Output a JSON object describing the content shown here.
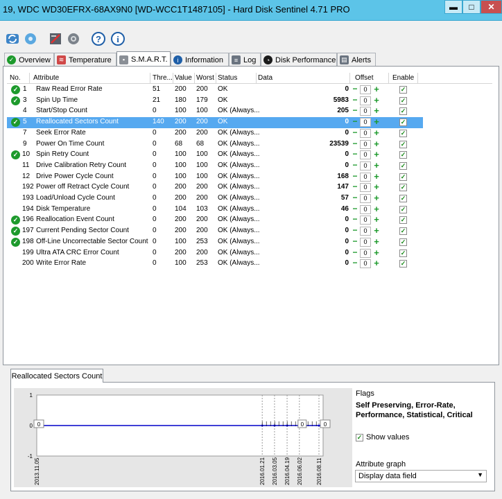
{
  "window": {
    "title": "19, WDC WD30EFRX-68AX9N0 [WD-WCC1T1487105]  -  Hard Disk Sentinel 4.71 PRO",
    "min_glyph": "▬",
    "max_glyph": "□",
    "close_glyph": "✕"
  },
  "toolbar": {
    "icons": [
      "refresh-icon",
      "disk-settings-icon",
      "report-icon",
      "settings-icon",
      "help-icon",
      "info-icon"
    ]
  },
  "tabs": [
    {
      "label": "Overview",
      "icon": "check-icon"
    },
    {
      "label": "Temperature",
      "icon": "thermometer-icon"
    },
    {
      "label": "S.M.A.R.T.",
      "icon": "smart-icon",
      "active": true
    },
    {
      "label": "Information",
      "icon": "info-icon"
    },
    {
      "label": "Log",
      "icon": "log-icon"
    },
    {
      "label": "Disk Performance",
      "icon": "performance-icon"
    },
    {
      "label": "Alerts",
      "icon": "alerts-icon"
    }
  ],
  "grid": {
    "headers": [
      "No.",
      "Attribute",
      "Thre...",
      "Value",
      "Worst",
      "Status",
      "Data",
      "Offset",
      "Enable"
    ],
    "rows": [
      {
        "ok": true,
        "no": "1",
        "attr": "Raw Read Error Rate",
        "thr": "51",
        "val": "200",
        "worst": "200",
        "status": "OK",
        "data": "0",
        "offset": "0"
      },
      {
        "ok": true,
        "no": "3",
        "attr": "Spin Up Time",
        "thr": "21",
        "val": "180",
        "worst": "179",
        "status": "OK",
        "data": "5983",
        "offset": "0"
      },
      {
        "ok": false,
        "no": "4",
        "attr": "Start/Stop Count",
        "thr": "0",
        "val": "100",
        "worst": "100",
        "status": "OK (Always...",
        "data": "205",
        "offset": "0"
      },
      {
        "ok": true,
        "no": "5",
        "attr": "Reallocated Sectors Count",
        "thr": "140",
        "val": "200",
        "worst": "200",
        "status": "OK",
        "data": "0",
        "offset": "0",
        "selected": true
      },
      {
        "ok": false,
        "no": "7",
        "attr": "Seek Error Rate",
        "thr": "0",
        "val": "200",
        "worst": "200",
        "status": "OK (Always...",
        "data": "0",
        "offset": "0"
      },
      {
        "ok": false,
        "no": "9",
        "attr": "Power On Time Count",
        "thr": "0",
        "val": "68",
        "worst": "68",
        "status": "OK (Always...",
        "data": "23539",
        "offset": "0"
      },
      {
        "ok": true,
        "no": "10",
        "attr": "Spin Retry Count",
        "thr": "0",
        "val": "100",
        "worst": "100",
        "status": "OK (Always...",
        "data": "0",
        "offset": "0"
      },
      {
        "ok": false,
        "no": "11",
        "attr": "Drive Calibration Retry Count",
        "thr": "0",
        "val": "100",
        "worst": "100",
        "status": "OK (Always...",
        "data": "0",
        "offset": "0"
      },
      {
        "ok": false,
        "no": "12",
        "attr": "Drive Power Cycle Count",
        "thr": "0",
        "val": "100",
        "worst": "100",
        "status": "OK (Always...",
        "data": "168",
        "offset": "0"
      },
      {
        "ok": false,
        "no": "192",
        "attr": "Power off Retract Cycle Count",
        "thr": "0",
        "val": "200",
        "worst": "200",
        "status": "OK (Always...",
        "data": "147",
        "offset": "0"
      },
      {
        "ok": false,
        "no": "193",
        "attr": "Load/Unload Cycle Count",
        "thr": "0",
        "val": "200",
        "worst": "200",
        "status": "OK (Always...",
        "data": "57",
        "offset": "0"
      },
      {
        "ok": false,
        "no": "194",
        "attr": "Disk Temperature",
        "thr": "0",
        "val": "104",
        "worst": "103",
        "status": "OK (Always...",
        "data": "46",
        "offset": "0"
      },
      {
        "ok": true,
        "no": "196",
        "attr": "Reallocation Event Count",
        "thr": "0",
        "val": "200",
        "worst": "200",
        "status": "OK (Always...",
        "data": "0",
        "offset": "0"
      },
      {
        "ok": true,
        "no": "197",
        "attr": "Current Pending Sector Count",
        "thr": "0",
        "val": "200",
        "worst": "200",
        "status": "OK (Always...",
        "data": "0",
        "offset": "0"
      },
      {
        "ok": true,
        "no": "198",
        "attr": "Off-Line Uncorrectable Sector Count",
        "thr": "0",
        "val": "100",
        "worst": "253",
        "status": "OK (Always...",
        "data": "0",
        "offset": "0"
      },
      {
        "ok": false,
        "no": "199",
        "attr": "Ultra ATA CRC Error Count",
        "thr": "0",
        "val": "200",
        "worst": "200",
        "status": "OK (Always...",
        "data": "0",
        "offset": "0"
      },
      {
        "ok": false,
        "no": "200",
        "attr": "Write Error Rate",
        "thr": "0",
        "val": "100",
        "worst": "253",
        "status": "OK (Always...",
        "data": "0",
        "offset": "0"
      }
    ]
  },
  "lower": {
    "tab_label": "Reallocated Sectors Count",
    "flags_title": "Flags",
    "flags_value": "Self Preserving, Error-Rate, Performance, Statistical, Critical",
    "show_values_label": "Show values",
    "show_values_checked": true,
    "attribute_graph_label": "Attribute graph",
    "attribute_graph_value": "Display data field"
  },
  "chart_data": {
    "type": "line",
    "x": [
      "2013.11.05",
      "2016.01.21",
      "2016.03.05",
      "2016.04.19",
      "2016.06.02",
      "2016.08.11"
    ],
    "series": [
      {
        "values": [
          0,
          0,
          0,
          0,
          0,
          0
        ]
      }
    ],
    "ylim": [
      -1,
      1
    ],
    "yticks": [
      "1",
      "0",
      "-1"
    ],
    "value_labels": [
      "0",
      "0",
      "0"
    ],
    "colors": {
      "line": "#0000c8",
      "points": "#0000c8"
    }
  }
}
